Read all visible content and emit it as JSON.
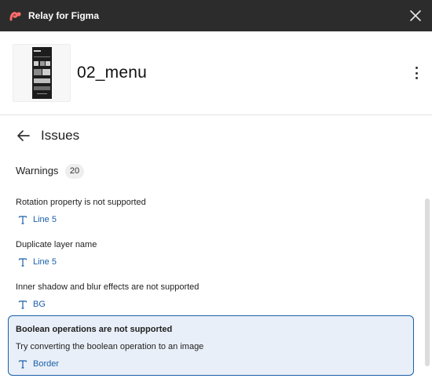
{
  "app": {
    "title": "Relay for Figma",
    "logo_icon": "relay-logo-icon",
    "close_icon": "close-icon",
    "titlebar_color": "#2c2c2c",
    "logo_color": "#ff6b6b"
  },
  "component": {
    "name": "02_menu"
  },
  "issues_panel": {
    "title": "Issues",
    "warnings_label": "Warnings",
    "warnings_count": "20",
    "items": [
      {
        "message": "Rotation property is not supported",
        "layer_type_icon": "text-layer-icon",
        "layer": "Line 5"
      },
      {
        "message": "Duplicate layer name",
        "layer_type_icon": "text-layer-icon",
        "layer": "Line 5"
      },
      {
        "message": "Inner shadow and blur effects are not supported",
        "layer_type_icon": "text-layer-icon",
        "layer": "BG"
      },
      {
        "message": "Boolean operations are not supported",
        "hint": "Try converting the boolean operation to an image",
        "layer_type_icon": "text-layer-icon",
        "layer": "Border",
        "selected": true
      }
    ]
  },
  "colors": {
    "link": "#1a5fa8",
    "selected_background": "#e9eff8",
    "selected_border": "#1a5fa8"
  }
}
